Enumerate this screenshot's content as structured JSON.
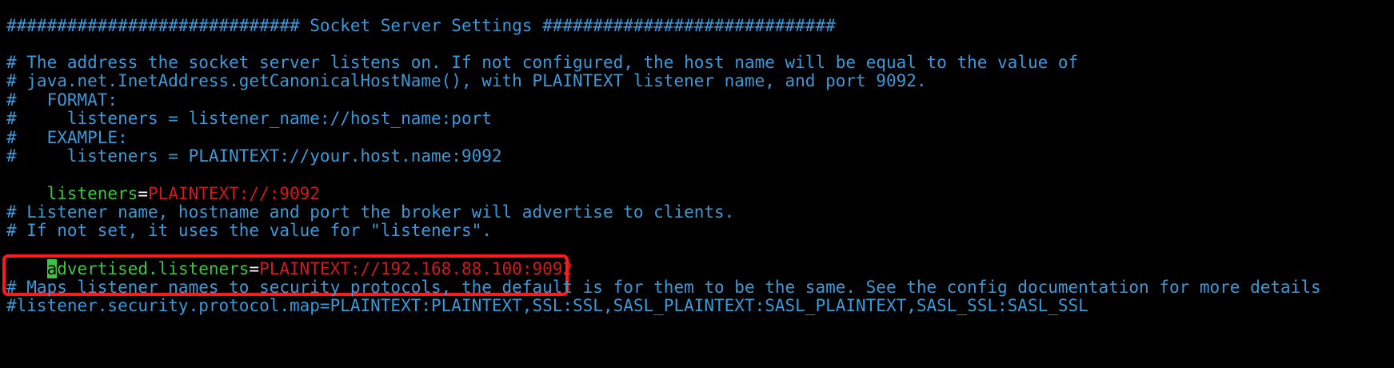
{
  "editor": {
    "colors": {
      "background": "#000000",
      "comment": "#3a9ad9",
      "key": "#3fc43f",
      "value": "#d21a1a",
      "cursor": "#3fc43f",
      "highlight_box": "#ff1a1a"
    },
    "lines": {
      "section_header": "############################# Socket Server Settings #############################",
      "c1": "# The address the socket server listens on. If not configured, the host name will be equal to the value of",
      "c2": "# java.net.InetAddress.getCanonicalHostName(), with PLAINTEXT listener name, and port 9092.",
      "c3": "#   FORMAT:",
      "c4": "#     listeners = listener_name://host_name:port",
      "c5": "#   EXAMPLE:",
      "c6": "#     listeners = PLAINTEXT://your.host.name:9092",
      "listeners": {
        "key": "listeners",
        "eq": "=",
        "value": "PLAINTEXT://:9092"
      },
      "c7": "# Listener name, hostname and port the broker will advertise to clients.",
      "c8": "# If not set, it uses the value for \"listeners\".",
      "advertised": {
        "cursor_char": "a",
        "key_rest": "dvertised.listeners",
        "eq": "=",
        "value": "PLAINTEXT://192.168.88.100:9092"
      },
      "c9": "# Maps listener names to security protocols, the default is for them to be the same. See the config documentation for more details",
      "c10": "#listener.security.protocol.map=PLAINTEXT:PLAINTEXT,SSL:SSL,SASL_PLAINTEXT:SASL_PLAINTEXT,SASL_SSL:SASL_SSL"
    }
  }
}
